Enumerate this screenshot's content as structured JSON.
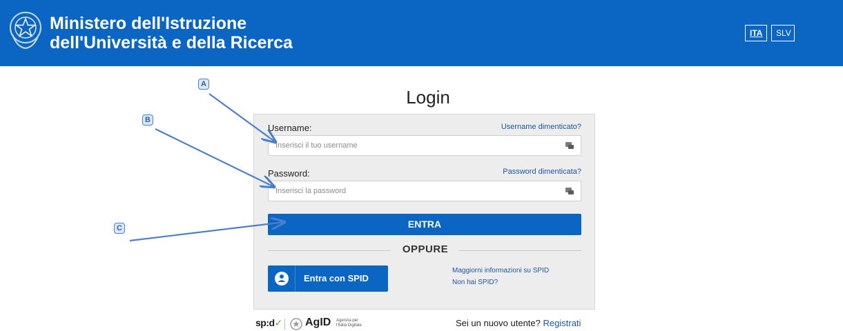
{
  "header": {
    "ministry_line1": "Ministero dell'Istruzione",
    "ministry_line2": "dell'Università e della Ricerca",
    "lang_ita": "ITA",
    "lang_slv": "SLV"
  },
  "login": {
    "title": "Login",
    "username_label": "Username:",
    "username_forgot": "Username dimenticato?",
    "username_placeholder": "Inserisci il tuo username",
    "password_label": "Password:",
    "password_forgot": "Password dimenticata?",
    "password_placeholder": "Inserisci la password",
    "submit_label": "ENTRA",
    "or_label": "OPPURE",
    "spid_button_label": "Entra con SPID",
    "spid_more_info": "Maggiorni informazioni su SPID",
    "spid_no_account": "Non hai SPID?"
  },
  "footer": {
    "spid_logo_text": "sp:d",
    "agid_logo_text": "AgID",
    "agid_sub_line1": "Agenzia per",
    "agid_sub_line2": "l'Italia Digitale",
    "new_user_text": "Sei un nuovo utente?",
    "register_link": "Registrati"
  },
  "annotations": {
    "a": "A",
    "b": "B",
    "c": "C"
  },
  "colors": {
    "primary": "#0a66c2",
    "link": "#1b56a8",
    "card_bg": "#ededed",
    "annotation": "#4a7fcf"
  }
}
